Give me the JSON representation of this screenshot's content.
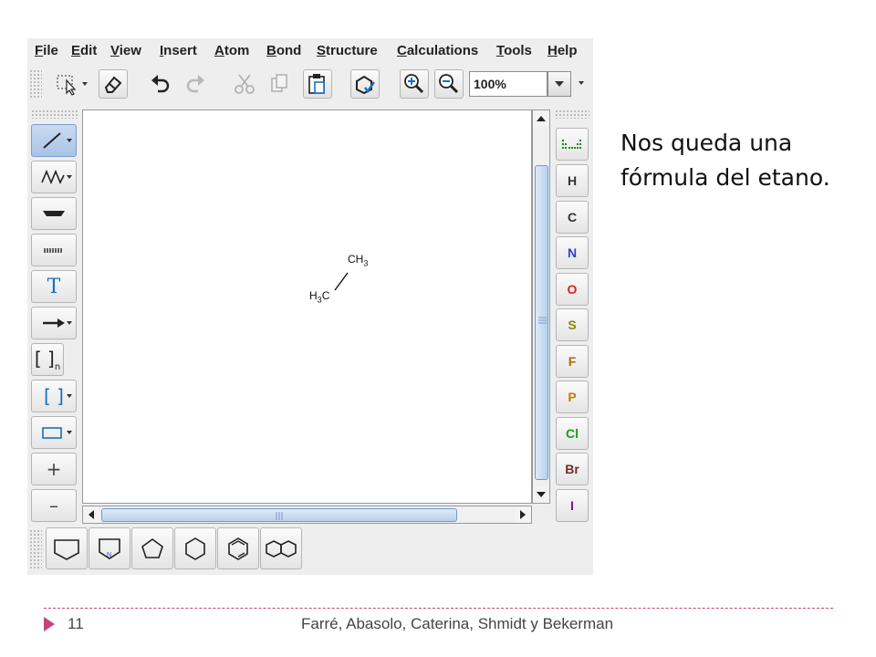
{
  "menubar": {
    "items": [
      {
        "label": "File",
        "mnemonic": "F",
        "rest": "ile"
      },
      {
        "label": "Edit",
        "mnemonic": "E",
        "rest": "dit"
      },
      {
        "label": "View",
        "mnemonic": "V",
        "rest": "iew"
      },
      {
        "label": "Insert",
        "mnemonic": "I",
        "rest": "nsert"
      },
      {
        "label": "Atom",
        "mnemonic": "A",
        "rest": "tom"
      },
      {
        "label": "Bond",
        "mnemonic": "B",
        "rest": "ond"
      },
      {
        "label": "Structure",
        "mnemonic": "S",
        "rest": "tructure"
      },
      {
        "label": "Calculations",
        "mnemonic": "C",
        "rest": "alculations"
      },
      {
        "label": "Tools",
        "mnemonic": "T",
        "rest": "ools"
      },
      {
        "label": "Help",
        "mnemonic": "H",
        "rest": "elp"
      }
    ]
  },
  "toolbar": {
    "zoom_value": "100%",
    "icons": [
      "selection-icon",
      "eraser-icon",
      "undo-icon",
      "redo-icon",
      "cut-icon",
      "copy-icon",
      "paste-icon",
      "clean-structure-icon",
      "zoom-in-icon",
      "zoom-out-icon"
    ]
  },
  "left_tools": [
    {
      "name": "single-bond-tool",
      "icon": "single-bond-icon",
      "active": true
    },
    {
      "name": "chain-tool",
      "icon": "chain-icon"
    },
    {
      "name": "wedge-bond-tool",
      "icon": "wedge-bond-icon"
    },
    {
      "name": "hashed-bond-tool",
      "icon": "hashed-bond-icon"
    },
    {
      "name": "text-tool",
      "icon": "text-icon",
      "label": "T"
    },
    {
      "name": "reaction-arrow-tool",
      "icon": "arrow-icon"
    },
    {
      "name": "sgroup-tool",
      "icon": "bracket-n-icon",
      "label": "[ ]",
      "sub": "n"
    },
    {
      "name": "bracket-tool",
      "icon": "bracket-icon",
      "label": "[ ]"
    },
    {
      "name": "rectangle-tool",
      "icon": "rectangle-icon"
    },
    {
      "name": "positive-charge-tool",
      "icon": "plus-icon",
      "label": "+"
    },
    {
      "name": "negative-charge-tool",
      "icon": "minus-icon",
      "label": "–"
    }
  ],
  "elements": [
    {
      "symbol": "H",
      "color": "#333333"
    },
    {
      "symbol": "C",
      "color": "#333333"
    },
    {
      "symbol": "N",
      "color": "#2f3fd0"
    },
    {
      "symbol": "O",
      "color": "#e02020"
    },
    {
      "symbol": "S",
      "color": "#8a8a00"
    },
    {
      "symbol": "F",
      "color": "#a86a00"
    },
    {
      "symbol": "P",
      "color": "#c87a00"
    },
    {
      "symbol": "Cl",
      "color": "#18a018"
    },
    {
      "symbol": "Br",
      "color": "#7a2a2a"
    },
    {
      "symbol": "I",
      "color": "#7a10a0"
    }
  ],
  "templates": [
    "cyclopentane-chair-icon",
    "pyrrolidine-icon",
    "cyclopentane-icon",
    "cyclohexane-icon",
    "benzene-icon",
    "naphthalene-icon"
  ],
  "molecule": {
    "atom1": {
      "base": "CH",
      "sub": "3",
      "label": "CH3"
    },
    "atom2": {
      "base": "H",
      "sub": "3",
      "tail": "C",
      "label": "H3C"
    }
  },
  "slide": {
    "caption_line1": "Nos queda una",
    "caption_line2": "fórmula del etano.",
    "slide_number": "11",
    "authors": "Farré, Abasolo, Caterina, Shmidt y Bekerman",
    "accent_color": "#c0467c"
  }
}
